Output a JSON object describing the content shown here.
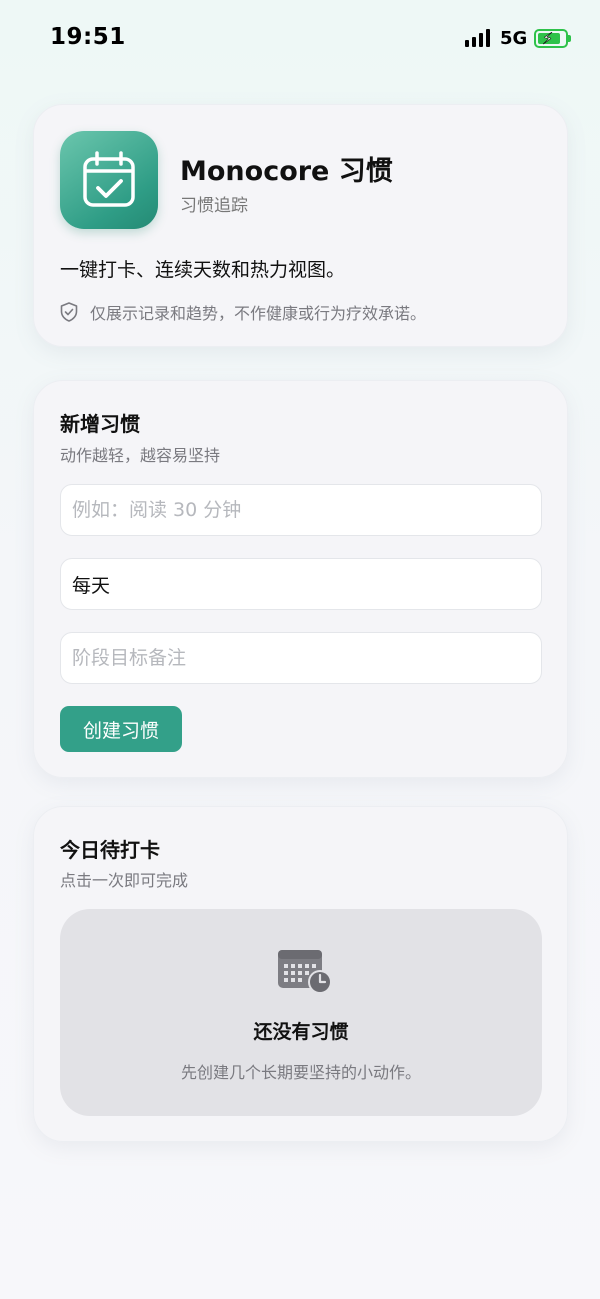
{
  "status_bar": {
    "time": "19:51",
    "network": "5G",
    "battery_icon": "battery-charging-icon",
    "signal_icon": "signal-bars-icon"
  },
  "app_card": {
    "icon": "calendar-check-icon",
    "title": "Monocore 习惯",
    "subtitle": "习惯追踪",
    "description": "一键打卡、连续天数和热力视图。",
    "disclaimer_icon": "shield-check-icon",
    "disclaimer": "仅展示记录和趋势，不作健康或行为疗效承诺。"
  },
  "new_habit": {
    "title": "新增习惯",
    "subtitle": "动作越轻，越容易坚持",
    "name_placeholder": "例如：阅读 30 分钟",
    "frequency_value": "每天",
    "note_placeholder": "阶段目标备注",
    "create_label": "创建习惯"
  },
  "today": {
    "title": "今日待打卡",
    "subtitle": "点击一次即可完成",
    "empty_icon": "calendar-clock-icon",
    "empty_title": "还没有习惯",
    "empty_subtitle": "先创建几个长期要坚持的小动作。"
  },
  "colors": {
    "accent": "#33a089",
    "icon_gradient_start": "#6bc6ad",
    "icon_gradient_end": "#248a74",
    "battery": "#2ec24a"
  }
}
